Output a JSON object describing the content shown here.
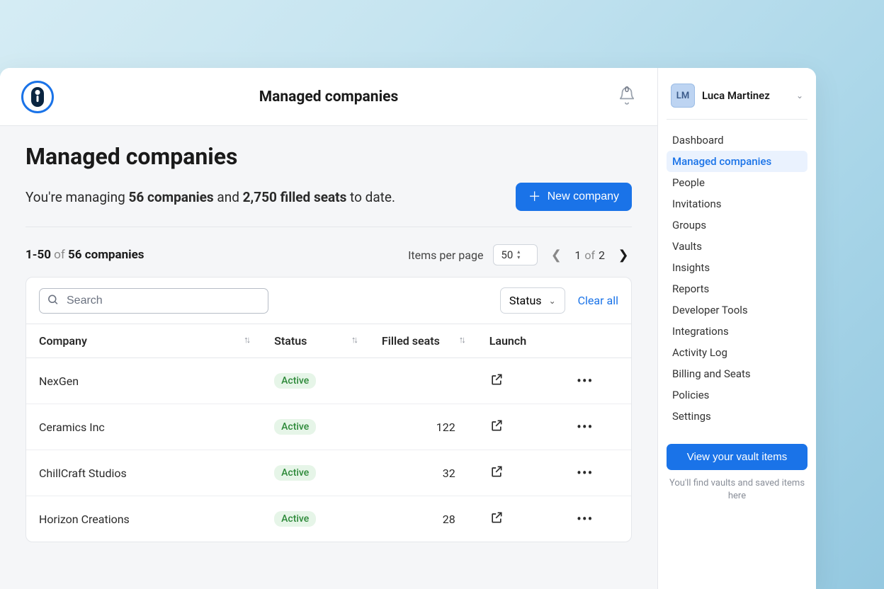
{
  "header": {
    "title": "Managed companies",
    "notification_count": "0"
  },
  "page": {
    "title": "Managed companies",
    "summary_prefix": "You're managing ",
    "company_count": "56 companies",
    "summary_mid": " and ",
    "filled_seats": "2,750 filled seats",
    "summary_suffix": " to date.",
    "new_company_label": "New company"
  },
  "pagination": {
    "range": "1-50",
    "of_label": " of ",
    "total_label": "56 companies",
    "items_per_page_label": "Items per page",
    "page_size": "50",
    "current_page": "1",
    "of": "of",
    "total_pages": "2"
  },
  "filters": {
    "search_placeholder": "Search",
    "status_label": "Status",
    "clear_all_label": "Clear all"
  },
  "columns": {
    "company": "Company",
    "status": "Status",
    "filled_seats": "Filled seats",
    "launch": "Launch"
  },
  "rows": [
    {
      "company": "NexGen",
      "status": "Active",
      "seats": ""
    },
    {
      "company": "Ceramics Inc",
      "status": "Active",
      "seats": "122"
    },
    {
      "company": "ChillCraft Studios",
      "status": "Active",
      "seats": "32"
    },
    {
      "company": "Horizon Creations",
      "status": "Active",
      "seats": "28"
    }
  ],
  "user": {
    "initials": "LM",
    "name": "Luca Martinez"
  },
  "nav": {
    "items": [
      "Dashboard",
      "Managed companies",
      "People",
      "Invitations",
      "Groups",
      "Vaults",
      "Insights",
      "Reports",
      "Developer Tools",
      "Integrations",
      "Activity Log",
      "Billing and Seats",
      "Policies",
      "Settings"
    ],
    "active_index": 1
  },
  "vault": {
    "button_label": "View your vault items",
    "hint": "You'll find vaults and saved items here"
  }
}
